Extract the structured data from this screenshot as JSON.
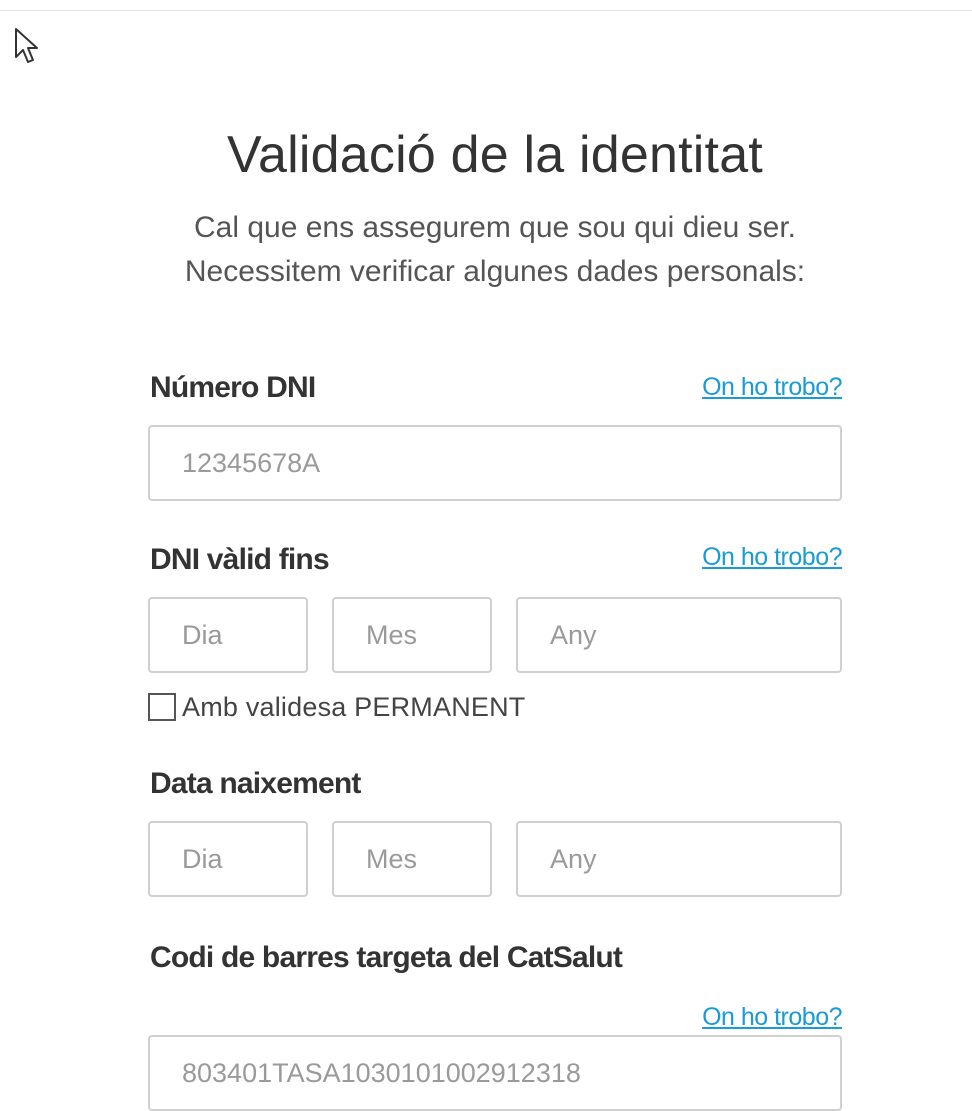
{
  "title": "Validació de la identitat",
  "subtitle": {
    "line1": "Cal que ens assegurem que sou qui dieu ser.",
    "line2": "Necessitem verificar algunes dades personals:"
  },
  "dni": {
    "label": "Número DNI",
    "help_link": "On ho trobo?",
    "placeholder": "12345678A"
  },
  "dni_valid_until": {
    "label": "DNI vàlid fins",
    "help_link": "On ho trobo?",
    "day_placeholder": "Dia",
    "month_placeholder": "Mes",
    "year_placeholder": "Any",
    "permanent_label": "Amb validesa PERMANENT"
  },
  "birth_date": {
    "label": "Data naixement",
    "day_placeholder": "Dia",
    "month_placeholder": "Mes",
    "year_placeholder": "Any"
  },
  "catsalut": {
    "label": "Codi de barres targeta del CatSalut",
    "help_link": "On ho trobo?",
    "placeholder": "803401TASA1030101002912318"
  },
  "icons": {
    "cursor": "mouse-pointer-icon"
  },
  "colors": {
    "link": "#1a9bd7",
    "text": "#333333",
    "placeholder": "#9a9a9a",
    "border": "#d0d0d0"
  }
}
